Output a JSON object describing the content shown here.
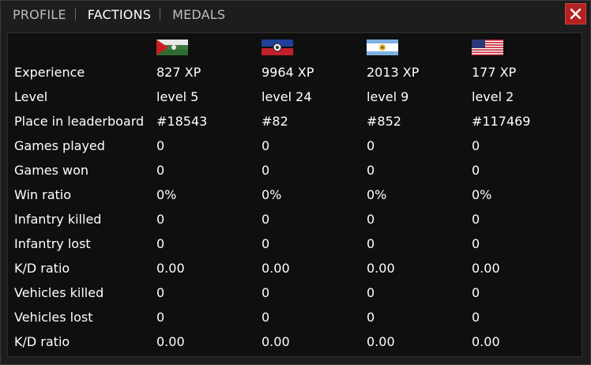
{
  "tabs": [
    {
      "label": "PROFILE",
      "active": false
    },
    {
      "label": "FACTIONS",
      "active": true
    },
    {
      "label": "MEDALS",
      "active": false
    }
  ],
  "close_icon": "close-x-icon",
  "colors": {
    "close_bg": "#b32121",
    "panel_bg": "#0f0f0f",
    "text": "#ffffff"
  },
  "factions": [
    {
      "flag": "faction-flag-green-white-red-icon"
    },
    {
      "flag": "faction-flag-blue-red-emblem-icon"
    },
    {
      "flag": "faction-flag-light-blue-white-emblem-icon"
    },
    {
      "flag": "faction-flag-usa-icon"
    }
  ],
  "rows": [
    {
      "label": "Experience",
      "values": [
        "827 XP",
        "9964 XP",
        "2013 XP",
        "177 XP"
      ]
    },
    {
      "label": "Level",
      "values": [
        "level 5",
        "level 24",
        "level 9",
        "level 2"
      ]
    },
    {
      "label": "Place in leaderboard",
      "values": [
        "#18543",
        "#82",
        "#852",
        "#117469"
      ]
    },
    {
      "label": "Games played",
      "values": [
        "0",
        "0",
        "0",
        "0"
      ]
    },
    {
      "label": "Games won",
      "values": [
        "0",
        "0",
        "0",
        "0"
      ]
    },
    {
      "label": "Win ratio",
      "values": [
        "0%",
        "0%",
        "0%",
        "0%"
      ]
    },
    {
      "label": "Infantry killed",
      "values": [
        "0",
        "0",
        "0",
        "0"
      ]
    },
    {
      "label": "Infantry lost",
      "values": [
        "0",
        "0",
        "0",
        "0"
      ]
    },
    {
      "label": "K/D ratio",
      "values": [
        "0.00",
        "0.00",
        "0.00",
        "0.00"
      ]
    },
    {
      "label": "Vehicles killed",
      "values": [
        "0",
        "0",
        "0",
        "0"
      ]
    },
    {
      "label": "Vehicles lost",
      "values": [
        "0",
        "0",
        "0",
        "0"
      ]
    },
    {
      "label": "K/D ratio",
      "values": [
        "0.00",
        "0.00",
        "0.00",
        "0.00"
      ]
    }
  ]
}
